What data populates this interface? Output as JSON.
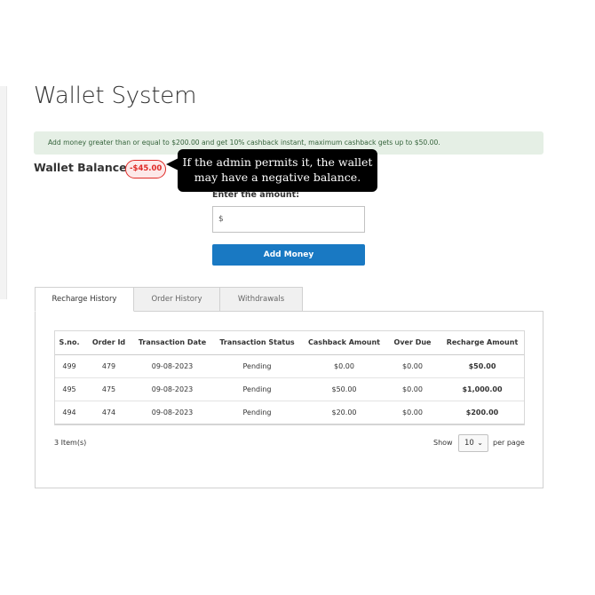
{
  "page": {
    "title": "Wallet System"
  },
  "notice": {
    "text": "Add money greater than or equal to $200.00 and get 10% cashback instant, maximum cashback gets up to $50.00."
  },
  "wallet": {
    "balance_label": "Wallet Balance :",
    "balance_value": "-$45.00",
    "balance_color": "#e02b27"
  },
  "callout": {
    "line1": "If the admin permits it, the wallet",
    "line2": "may have a negative balance."
  },
  "add_money": {
    "amount_label": "Enter the amount:",
    "input_value": "$",
    "button_label": "Add Money",
    "button_color": "#1979c3"
  },
  "tabs": [
    {
      "label": "Recharge History",
      "active": true
    },
    {
      "label": "Order History",
      "active": false
    },
    {
      "label": "Withdrawals",
      "active": false
    }
  ],
  "table": {
    "columns": [
      "S.no.",
      "Order Id",
      "Transaction Date",
      "Transaction Status",
      "Cashback Amount",
      "Over Due",
      "Recharge Amount"
    ],
    "rows": [
      [
        "499",
        "479",
        "09-08-2023",
        "Pending",
        "$0.00",
        "$0.00",
        "$50.00"
      ],
      [
        "495",
        "475",
        "09-08-2023",
        "Pending",
        "$50.00",
        "$0.00",
        "$1,000.00"
      ],
      [
        "494",
        "474",
        "09-08-2023",
        "Pending",
        "$20.00",
        "$0.00",
        "$200.00"
      ]
    ]
  },
  "pager": {
    "item_count": "3 Item(s)",
    "show_label": "Show",
    "limit_value": "10",
    "per_page_label": "per page",
    "chevron_icon": "chevron-down-icon"
  }
}
